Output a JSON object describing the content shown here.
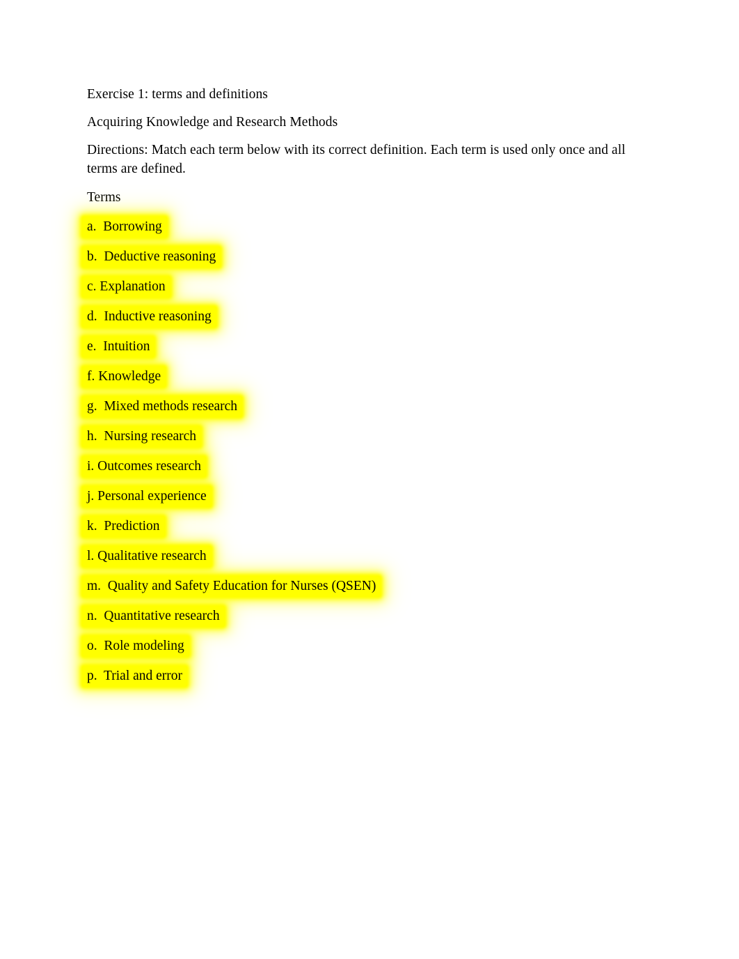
{
  "document": {
    "title_line": "Exercise 1: terms and definitions",
    "subtitle_line": "Acquiring Knowledge and Research Methods",
    "directions": "Directions: Match each term below with its correct definition. Each term is used only once and all terms are defined.",
    "terms_heading": "Terms",
    "highlight_color": "#ffff00",
    "page_background": "#ffffff",
    "text_color": "#000000",
    "terms": [
      {
        "marker": "a.",
        "label": "Borrowing",
        "text": "a.  Borrowing"
      },
      {
        "marker": "b.",
        "label": "Deductive reasoning",
        "text": "b.  Deductive reasoning"
      },
      {
        "marker": "c.",
        "label": "Explanation",
        "text": "c. Explanation"
      },
      {
        "marker": "d.",
        "label": "Inductive reasoning",
        "text": "d.  Inductive reasoning"
      },
      {
        "marker": "e.",
        "label": "Intuition",
        "text": "e.  Intuition"
      },
      {
        "marker": "f.",
        "label": "Knowledge",
        "text": "f. Knowledge"
      },
      {
        "marker": "g.",
        "label": "Mixed methods research",
        "text": "g.  Mixed methods research"
      },
      {
        "marker": "h.",
        "label": "Nursing research",
        "text": "h.  Nursing research"
      },
      {
        "marker": "i.",
        "label": "Outcomes research",
        "text": "i. Outcomes research"
      },
      {
        "marker": "j.",
        "label": "Personal experience",
        "text": "j. Personal experience"
      },
      {
        "marker": "k.",
        "label": "Prediction",
        "text": "k.  Prediction"
      },
      {
        "marker": "l.",
        "label": "Qualitative research",
        "text": "l. Qualitative research"
      },
      {
        "marker": "m.",
        "label": "Quality and Safety Education for Nurses (QSEN)",
        "text": "m.  Quality and Safety Education for Nurses (QSEN)"
      },
      {
        "marker": "n.",
        "label": "Quantitative research",
        "text": "n.  Quantitative research"
      },
      {
        "marker": "o.",
        "label": "Role modeling",
        "text": "o.  Role modeling"
      },
      {
        "marker": "p.",
        "label": "Trial and error",
        "text": "p.  Trial and error"
      }
    ]
  }
}
